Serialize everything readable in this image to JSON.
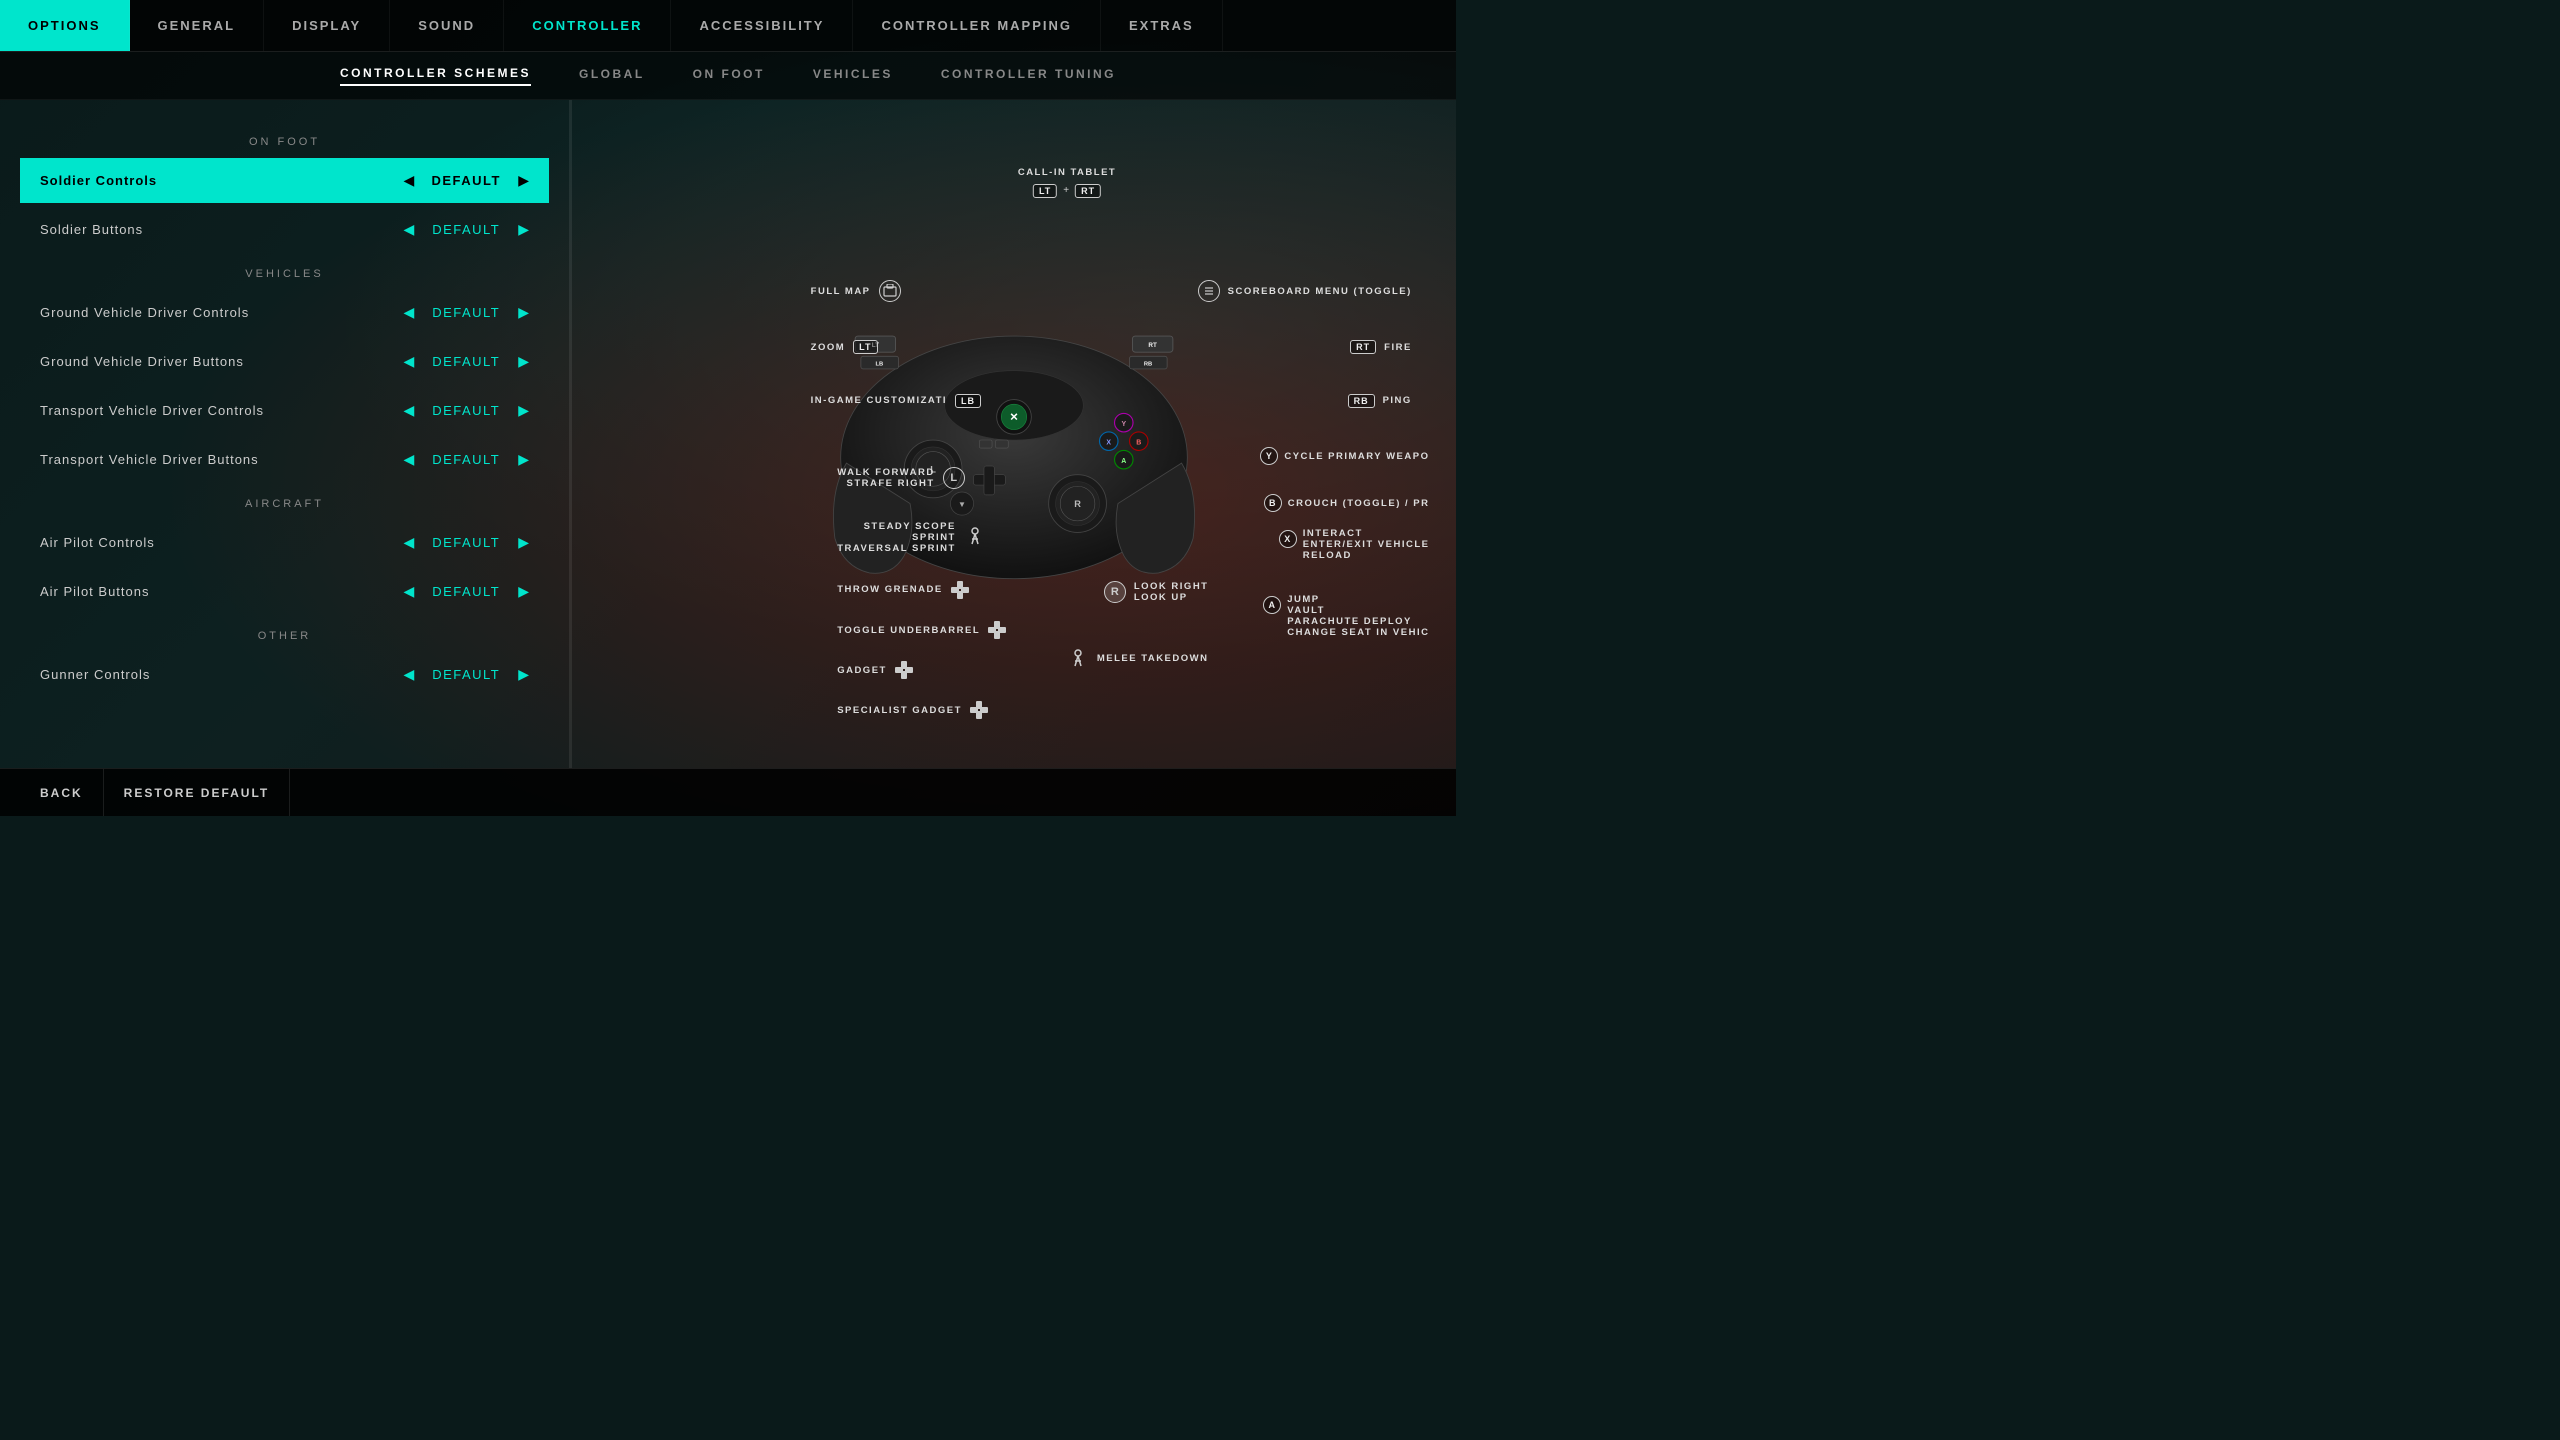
{
  "topNav": {
    "items": [
      {
        "id": "options",
        "label": "OPTIONS",
        "active": true
      },
      {
        "id": "general",
        "label": "GENERAL",
        "active": false
      },
      {
        "id": "display",
        "label": "DISPLAY",
        "active": false
      },
      {
        "id": "sound",
        "label": "SOUND",
        "active": false
      },
      {
        "id": "controller",
        "label": "CONTROLLER",
        "active": true,
        "highlighted": true
      },
      {
        "id": "accessibility",
        "label": "ACCESSIBILITY",
        "active": false
      },
      {
        "id": "controller-mapping",
        "label": "CONTROLLER MAPPING",
        "active": false
      },
      {
        "id": "extras",
        "label": "EXTRAS",
        "active": false
      }
    ]
  },
  "subNav": {
    "items": [
      {
        "id": "controller-schemes",
        "label": "CONTROLLER SCHEMES",
        "active": true
      },
      {
        "id": "global",
        "label": "GLOBAL",
        "active": false
      },
      {
        "id": "on-foot",
        "label": "ON FOOT",
        "active": false
      },
      {
        "id": "vehicles",
        "label": "VEHICLES",
        "active": false
      },
      {
        "id": "controller-tuning",
        "label": "CONTROLLER TUNING",
        "active": false
      }
    ]
  },
  "leftPanel": {
    "sections": [
      {
        "id": "on-foot",
        "label": "ON FOOT",
        "items": [
          {
            "id": "soldier-controls",
            "name": "Soldier Controls",
            "value": "DEFAULT",
            "highlighted": true
          },
          {
            "id": "soldier-buttons",
            "name": "Soldier Buttons",
            "value": "DEFAULT",
            "highlighted": false
          }
        ]
      },
      {
        "id": "vehicles",
        "label": "VEHICLES",
        "items": [
          {
            "id": "ground-vehicle-driver-controls",
            "name": "Ground Vehicle Driver Controls",
            "value": "DEFAULT",
            "highlighted": false
          },
          {
            "id": "ground-vehicle-driver-buttons",
            "name": "Ground Vehicle Driver Buttons",
            "value": "DEFAULT",
            "highlighted": false
          },
          {
            "id": "transport-vehicle-driver-controls",
            "name": "Transport Vehicle Driver Controls",
            "value": "DEFAULT",
            "highlighted": false
          },
          {
            "id": "transport-vehicle-driver-buttons",
            "name": "Transport Vehicle Driver Buttons",
            "value": "DEFAULT",
            "highlighted": false
          }
        ]
      },
      {
        "id": "aircraft",
        "label": "AIRCRAFT",
        "items": [
          {
            "id": "air-pilot-controls",
            "name": "Air Pilot Controls",
            "value": "DEFAULT",
            "highlighted": false
          },
          {
            "id": "air-pilot-buttons",
            "name": "Air Pilot Buttons",
            "value": "DEFAULT",
            "highlighted": false
          }
        ]
      },
      {
        "id": "other",
        "label": "OTHER",
        "items": [
          {
            "id": "gunner-controls",
            "name": "Gunner Controls",
            "value": "DEFAULT",
            "highlighted": false
          }
        ]
      }
    ]
  },
  "controller": {
    "callInTablet": "CALL-IN TABLET",
    "callInKeys": "LT + RT",
    "fullMap": "FULL MAP",
    "zoom": "ZOOM",
    "zoomKey": "LT",
    "inGameCustomization": "IN-GAME CUSTOMIZATI",
    "inGameKey": "LB",
    "scoreboardMenu": "SCOREBOARD MENU (TOGGLE)",
    "fire": "FIRE",
    "fireKey": "RT",
    "ping": "PING",
    "pingKey": "RB",
    "cyclePrimary": "CYCLE PRIMARY WEAPO",
    "cycleKey": "Y",
    "crouch": "CROUCH (TOGGLE) / PR",
    "crouchKey": "B",
    "interact": "INTERACT",
    "enterExit": "ENTER/EXIT VEHICLE",
    "reload": "RELOAD",
    "interactKey": "X",
    "jump": "JUMP",
    "vault": "VAULT",
    "parachute": "PARACHUTE DEPLOY",
    "changeSeat": "CHANGE SEAT IN VEHIC",
    "jumpKey": "A",
    "walkForward": "WALK FORWARD",
    "strafeRight": "STRAFE RIGHT",
    "walkKey": "L",
    "steadyScope": "STEADY SCOPE",
    "sprint": "SPRINT",
    "traversalSprint": "TRAVERSAL SPRINT",
    "throwGrenade": "THROW GRENADE",
    "toggleUnderbarrel": "TOGGLE UNDERBARREL",
    "gadget": "GADGET",
    "specialistGadget": "SPECIALIST GADGET",
    "lookRight": "LOOK RIGHT",
    "lookUp": "LOOK UP",
    "lookKey": "R",
    "meleeTakedown": "MELEE TAKEDOWN"
  },
  "bottomBar": {
    "back": "BACK",
    "restoreDefault": "RESTORE DEFAULT"
  }
}
